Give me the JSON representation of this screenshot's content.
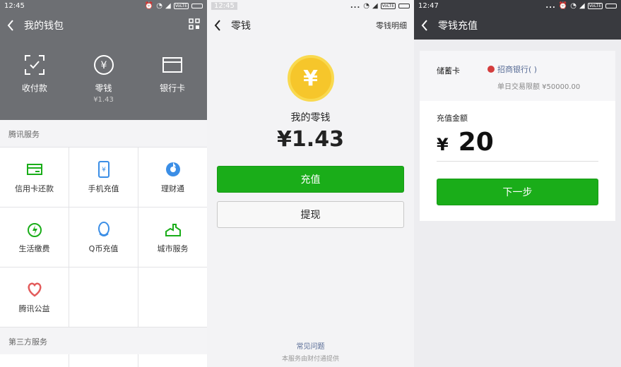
{
  "screen1": {
    "status": {
      "time": "12:45",
      "volte": "VoLTE"
    },
    "header": {
      "title": "我的钱包"
    },
    "quick": [
      {
        "label": "收付款",
        "sub": "",
        "icon": "scan-pay-icon"
      },
      {
        "label": "零钱",
        "sub": "¥1.43",
        "icon": "yuan-coin-icon"
      },
      {
        "label": "银行卡",
        "sub": "",
        "icon": "bank-card-icon"
      }
    ],
    "section1": "腾讯服务",
    "services": [
      {
        "label": "信用卡还款",
        "icon": "credit-card-icon",
        "color": "#1aad19"
      },
      {
        "label": "手机充值",
        "icon": "mobile-topup-icon",
        "color": "#3b8ee6"
      },
      {
        "label": "理财通",
        "icon": "wealth-icon",
        "color": "#3b8ee6"
      },
      {
        "label": "生活缴费",
        "icon": "utility-bolt-icon",
        "color": "#1aad19"
      },
      {
        "label": "Q币充值",
        "icon": "qq-penguin-icon",
        "color": "#3b8ee6"
      },
      {
        "label": "城市服务",
        "icon": "city-service-icon",
        "color": "#1aad19"
      },
      {
        "label": "腾讯公益",
        "icon": "charity-heart-icon",
        "color": "#e35b5b"
      }
    ],
    "section2": "第三方服务"
  },
  "screen2": {
    "status": {
      "time": "12:45",
      "volte": "VoLTE"
    },
    "header": {
      "title": "零钱",
      "right": "零钱明细"
    },
    "coin_symbol": "¥",
    "balance_label": "我的零钱",
    "balance": "¥1.43",
    "recharge": "充值",
    "withdraw": "提现",
    "faq": "常见问题",
    "provider": "本服务由财付通提供"
  },
  "screen3": {
    "status": {
      "time": "12:47",
      "volte": "VoLTE"
    },
    "header": {
      "title": "零钱充值"
    },
    "card_type": "储蓄卡",
    "bank": "招商银行(        )",
    "limit": "单日交易限额 ¥50000.00",
    "amount_label": "充值金额",
    "currency": "¥",
    "amount": "20",
    "next": "下一步"
  },
  "colors": {
    "green": "#1aad19",
    "link": "#576b95",
    "coin": "#f6c62b"
  }
}
